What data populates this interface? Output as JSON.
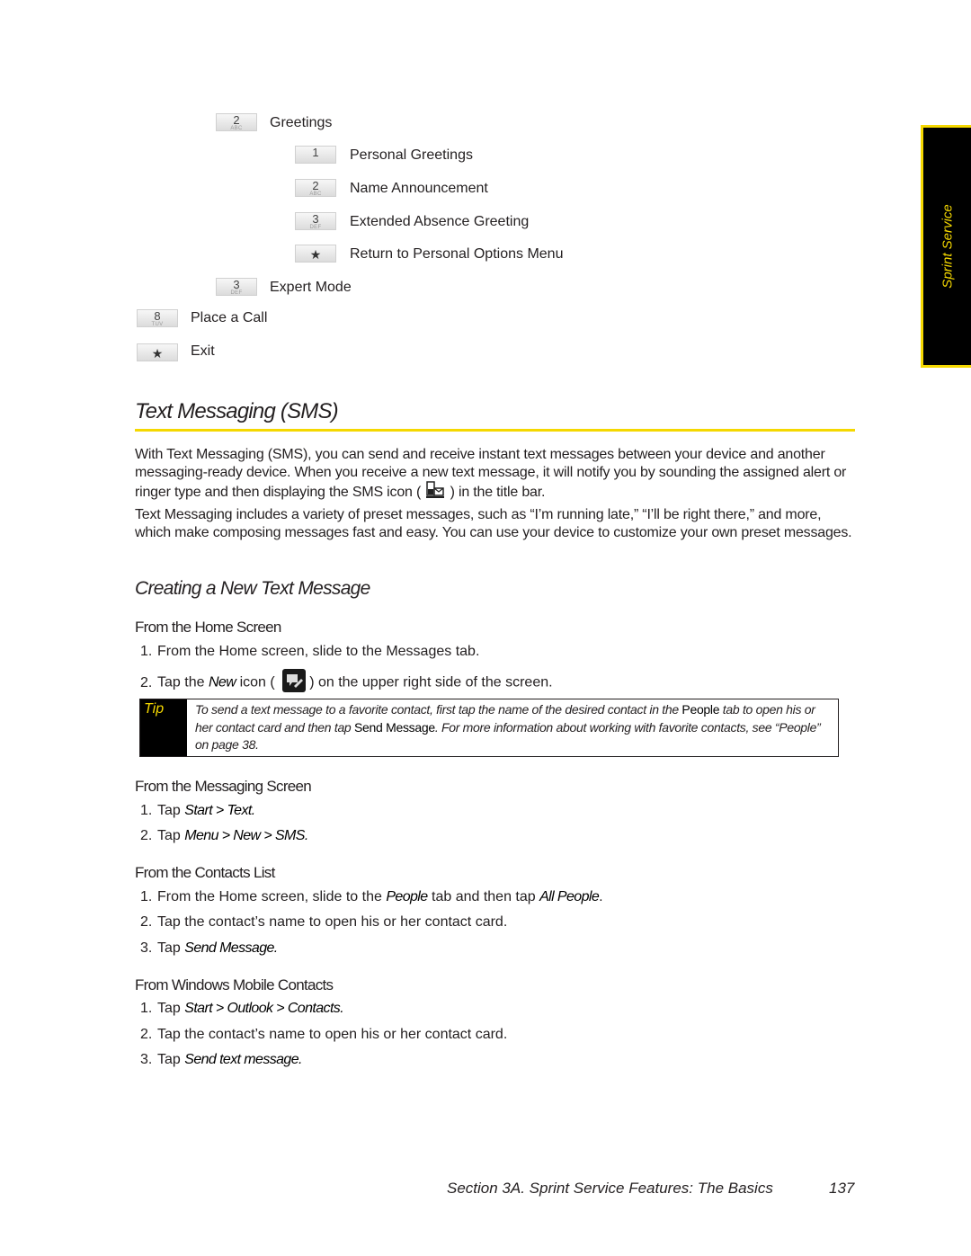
{
  "side_tab": {
    "label": "Sprint Service"
  },
  "menu": {
    "items": [
      {
        "key": "2",
        "sub": "ABC",
        "label": "Greetings",
        "level": 1
      },
      {
        "key": "1",
        "sub": "",
        "label": "Personal Greetings",
        "level": 2
      },
      {
        "key": "2",
        "sub": "ABC",
        "label": "Name Announcement",
        "level": 2
      },
      {
        "key": "3",
        "sub": "DEF",
        "label": "Extended Absence Greeting",
        "level": 2
      },
      {
        "key": "*",
        "sub": "",
        "label": "Return to Personal Options Menu",
        "level": 2
      },
      {
        "key": "3",
        "sub": "DEF",
        "label": "Expert Mode",
        "level": 1
      },
      {
        "key": "8",
        "sub": "TUV",
        "label": "Place a Call",
        "level": 0
      },
      {
        "key": "*",
        "sub": "",
        "label": "Exit",
        "level": 0
      }
    ]
  },
  "section": {
    "title": "Text Messaging (SMS)",
    "para1_a": "With Text Messaging (SMS), you can send and receive instant text messages between your device and another messaging-ready device. When you receive a new text message, it will notify you by sounding the assigned alert or ringer type and then displaying the SMS icon (",
    "para1_b": ") in the title bar.",
    "para2": "Text Messaging includes a variety of preset messages, such as “I’m running late,” “I’ll be right there,” and more, which make composing messages fast and easy. You can use your device to customize your own preset messages."
  },
  "subsection": {
    "title": "Creating a New Text Message",
    "home": {
      "heading": "From the Home Screen",
      "step1": "From the Home screen, slide to the Messages tab.",
      "step2_a": "Tap the ",
      "step2_em": "New",
      "step2_b": " icon (",
      "step2_c": ") on the upper right side of the screen."
    },
    "tip": {
      "label": "Tip",
      "t1": "To send a text message to a favorite contact, first tap the name of the desired contact in the ",
      "b1": "People",
      "t2": " tab to open his or her contact card and then tap ",
      "b2": "Send Message",
      "t3": ". For more information about working with favorite contacts, see “People” on page 38."
    },
    "messaging": {
      "heading": "From the Messaging Screen",
      "step1_a": "Tap ",
      "step1_em": "Start > Text.",
      "step2_a": "Tap ",
      "step2_em": "Menu > New > SMS."
    },
    "contacts": {
      "heading": "From the Contacts List",
      "step1_a": "From the Home screen, slide to the ",
      "step1_em1": "People",
      "step1_b": " tab and then tap ",
      "step1_em2": "All People",
      "step1_c": ".",
      "step2": "Tap the contact’s name to open his or her contact card.",
      "step3_a": "Tap ",
      "step3_em": "Send Message."
    },
    "wm_contacts": {
      "heading": "From Windows Mobile Contacts",
      "step1_a": "Tap ",
      "step1_em": "Start > Outlook > Contacts.",
      "step2": "Tap the contact’s name to open his or her contact card.",
      "step3_a": "Tap ",
      "step3_em": "Send text message."
    }
  },
  "footer": {
    "section": "Section 3A. Sprint Service Features: The Basics",
    "page": "137"
  },
  "colors": {
    "accent": "#f5d800",
    "text": "#231f20",
    "tab_bg": "#000000"
  }
}
